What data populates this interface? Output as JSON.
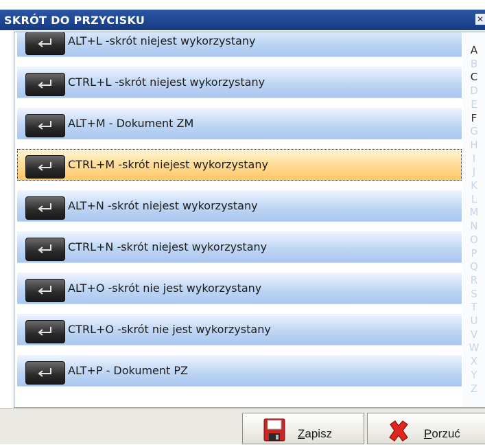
{
  "window": {
    "title": "SKRÓT DO PRZYCISKU",
    "close_glyph": "✕"
  },
  "list": {
    "items": [
      {
        "label": "ALT+L -skrót niejest wykorzystany",
        "icon": "enter-key-icon"
      },
      {
        "label": "CTRL+L -skrót niejest wykorzystany",
        "icon": "enter-key-icon"
      },
      {
        "label": "ALT+M - Dokument ZM",
        "icon": "enter-key-icon"
      },
      {
        "label": "CTRL+M -skrót niejest wykorzystany",
        "icon": "enter-key-icon",
        "selected": true
      },
      {
        "label": "ALT+N -skrót niejest wykorzystany",
        "icon": "enter-key-icon"
      },
      {
        "label": "CTRL+N -skrót niejest wykorzystany",
        "icon": "enter-key-icon"
      },
      {
        "label": "ALT+O -skrót nie jest wykorzystany",
        "icon": "enter-key-icon"
      },
      {
        "label": "CTRL+O -skrót nie jest wykorzystany",
        "icon": "enter-key-icon"
      },
      {
        "label": "ALT+P - Dokument PZ",
        "icon": "enter-key-icon"
      }
    ]
  },
  "alphabet": {
    "letters": [
      "A",
      "B",
      "C",
      "D",
      "E",
      "F",
      "G",
      "H",
      "I",
      "J",
      "K",
      "L",
      "M",
      "N",
      "O",
      "P",
      "Q",
      "R",
      "S",
      "T",
      "U",
      "V",
      "W",
      "X",
      "Y",
      "Z"
    ],
    "active": [
      "A",
      "C",
      "F"
    ]
  },
  "footer": {
    "save_label": "Zapisz",
    "save_icon": "floppy-disk-icon",
    "cancel_label": "Porzuć",
    "cancel_icon": "red-x-icon"
  },
  "colors": {
    "title_bar": "#1f4a96",
    "selected_row": "#ffc764",
    "row": "#bfd6f4"
  }
}
